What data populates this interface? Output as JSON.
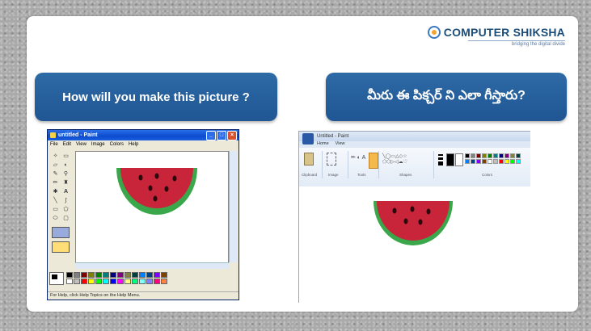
{
  "logo": {
    "brand": "COMPUTER SHIKSHA",
    "tagline": "bridging the digital divide"
  },
  "titles": {
    "left": "How will you make this picture ?",
    "right": "మీరు ఈ పిక్చర్ ని ఎలా గీస్తారు?"
  },
  "paint_xp": {
    "window_title": "untitled - Paint",
    "menu": [
      "File",
      "Edit",
      "View",
      "Image",
      "Colors",
      "Help"
    ],
    "status": "For Help, click Help Topics on the Help Menu.",
    "window_buttons": [
      "minimize-icon",
      "maximize-icon",
      "close-icon"
    ]
  },
  "paint7": {
    "window_title": "Untitled - Paint",
    "tabs": [
      "Home",
      "View"
    ],
    "groups": [
      "Clipboard",
      "Image",
      "Tools",
      "Shapes",
      "Colors"
    ]
  },
  "colors": {
    "title_box": "#2563a0",
    "melon_red": "#c8243a",
    "melon_green": "#3aa84a",
    "seed": "#2a0a0a"
  },
  "palette": [
    "#000000",
    "#808080",
    "#800000",
    "#808000",
    "#008000",
    "#008080",
    "#000080",
    "#800080",
    "#808040",
    "#004040",
    "#0080ff",
    "#004080",
    "#8000ff",
    "#804000",
    "#ffffff",
    "#c0c0c0",
    "#ff0000",
    "#ffff00",
    "#00ff00",
    "#00ffff",
    "#0000ff",
    "#ff00ff",
    "#ffff80",
    "#00ff80",
    "#80ffff",
    "#8080ff",
    "#ff0080",
    "#ff8040"
  ]
}
